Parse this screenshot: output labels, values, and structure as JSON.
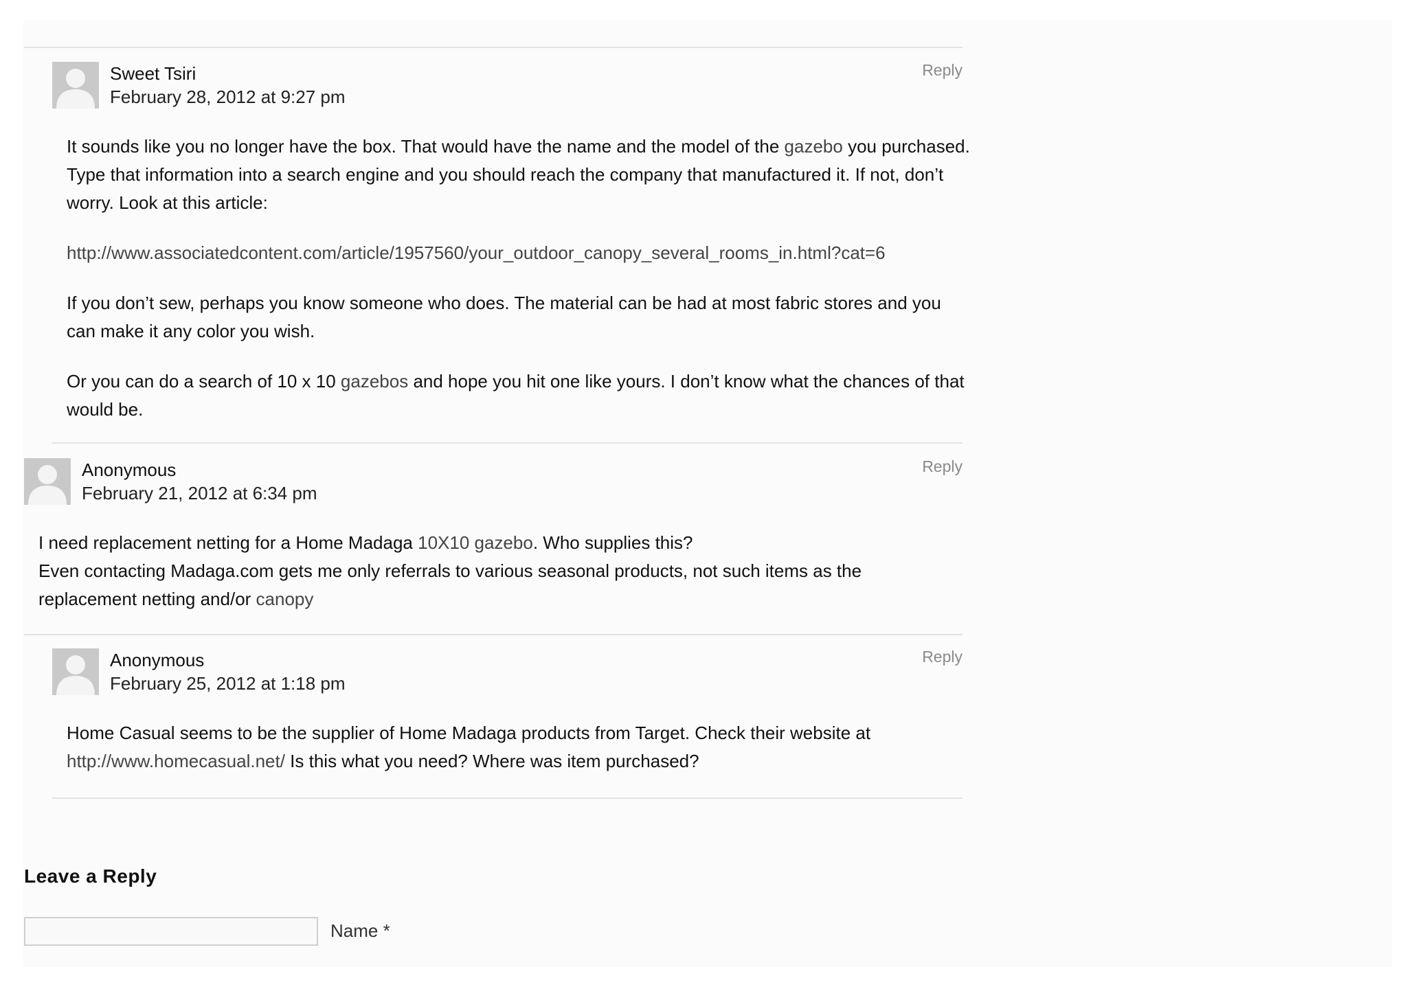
{
  "comments": [
    {
      "author": "Sweet Tsiri",
      "date": "February 28, 2012 at 9:27 pm",
      "reply_label": "Reply",
      "p1_before": "It sounds like you no longer have the box. That would have the name and the model of the ",
      "p1_link": "gazebo",
      "p1_after": " you purchased. Type that information into a search engine and you should reach the company that manufactured it. If not, don’t worry. Look at this article:",
      "p2_link": "http://www.associatedcontent.com/article/1957560/your_outdoor_canopy_several_rooms_in.html?cat=6",
      "p3": "If you don’t sew, perhaps you know someone who does. The material can be had at most fabric stores and you can make it any color you wish.",
      "p4_before": "Or you can do a search of 10 x 10 ",
      "p4_link": "gazebos",
      "p4_after": " and hope you hit one like yours. I don’t know what the chances of that would be."
    },
    {
      "author": "Anonymous",
      "date": "February 21, 2012 at 6:34 pm",
      "reply_label": "Reply",
      "p1_before": "I need replacement netting for a Home Madaga ",
      "p1_link": "10X10 gazebo",
      "p1_after": ". Who supplies this?",
      "p2_before": "Even contacting Madaga.com gets me only referrals to various seasonal products, not such items as the replacement netting and/or ",
      "p2_link": "canopy"
    },
    {
      "author": "Anonymous",
      "date": "February 25, 2012 at 1:18 pm",
      "reply_label": "Reply",
      "p1_before": "Home Casual seems to be the supplier of Home Madaga products from Target. Check their website at ",
      "p1_link": "http://www.homecasual.net/",
      "p1_after": " Is this what you need? Where was item purchased?"
    }
  ],
  "reply_form": {
    "title": "Leave a Reply",
    "name_label": "Name *",
    "name_value": ""
  },
  "colors": {
    "link": "#444444",
    "reply": "#8a8a8a",
    "rule": "#e3e3e3",
    "avatar": "#c9c9c9"
  }
}
